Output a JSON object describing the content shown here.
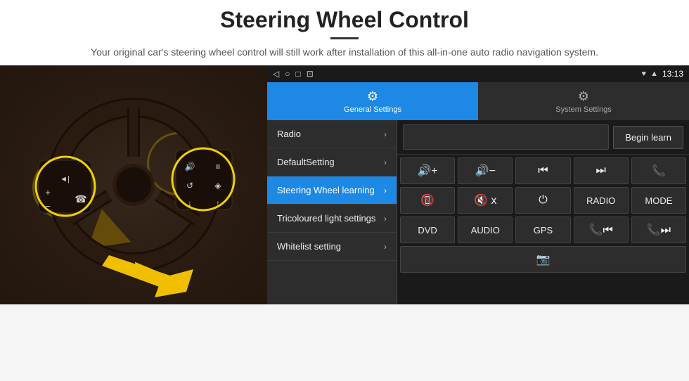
{
  "header": {
    "title": "Steering Wheel Control",
    "divider": true,
    "subtitle": "Your original car's steering wheel control will still work after installation of this all-in-one auto radio navigation system."
  },
  "statusBar": {
    "icons": [
      "◁",
      "○",
      "□",
      "⊡"
    ],
    "rightText": "13:13",
    "signals": [
      "♥",
      "▲"
    ]
  },
  "tabs": [
    {
      "id": "general",
      "label": "General Settings",
      "icon": "⚙",
      "active": true
    },
    {
      "id": "system",
      "label": "System Settings",
      "icon": "⚙",
      "active": false
    }
  ],
  "menuItems": [
    {
      "id": "radio",
      "label": "Radio",
      "active": false
    },
    {
      "id": "defaultsetting",
      "label": "DefaultSetting",
      "active": false
    },
    {
      "id": "steering",
      "label": "Steering Wheel learning",
      "active": true
    },
    {
      "id": "tricoloured",
      "label": "Tricoloured light settings",
      "active": false
    },
    {
      "id": "whitelist",
      "label": "Whitelist setting",
      "active": false
    }
  ],
  "rightPanel": {
    "beginLearnLabel": "Begin learn",
    "controlButtons": [
      [
        "vol+",
        "vol-",
        "prev",
        "next",
        "phone"
      ],
      [
        "hangup",
        "mute",
        "power",
        "RADIO",
        "MODE"
      ],
      [
        "DVD",
        "AUDIO",
        "GPS",
        "tel+prev",
        "tel+next"
      ],
      [
        "media"
      ]
    ]
  }
}
